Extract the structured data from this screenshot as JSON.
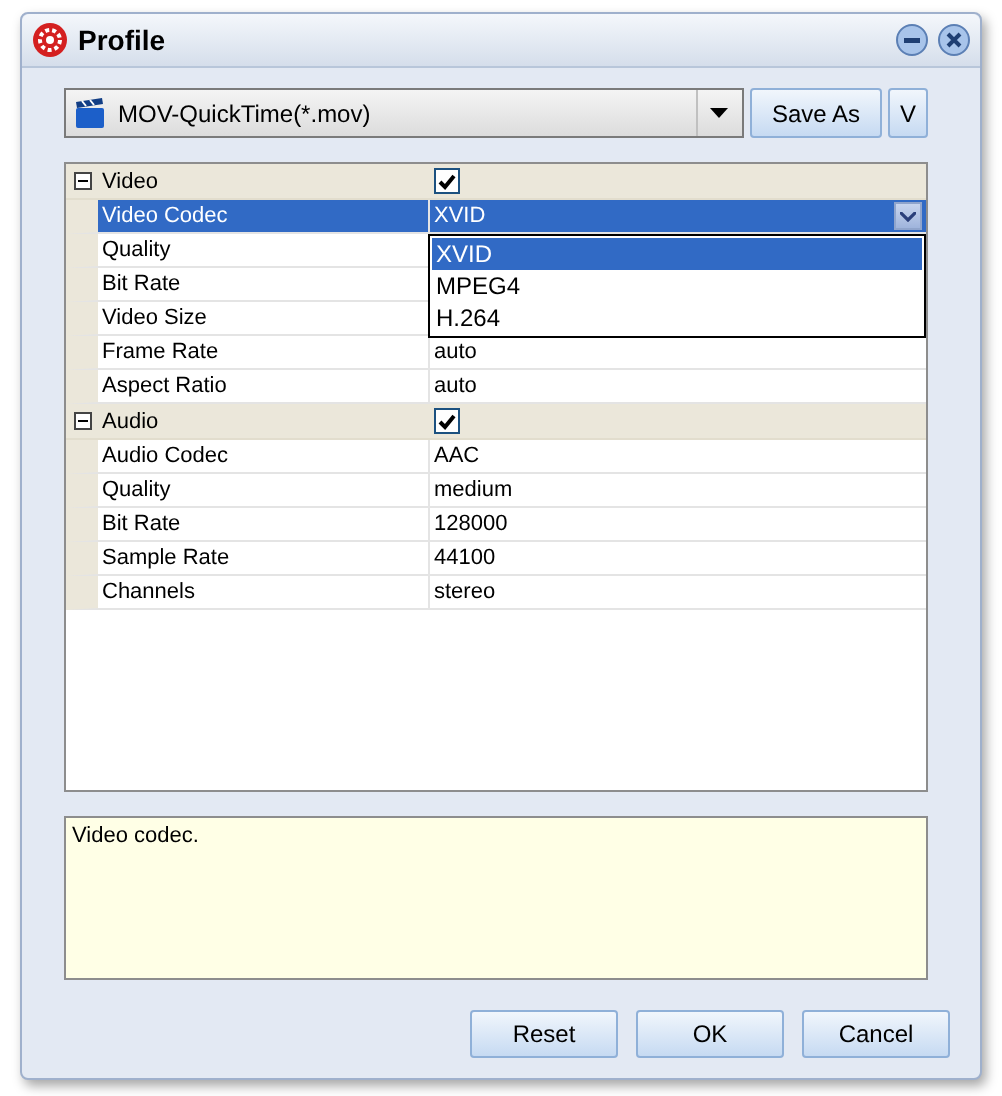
{
  "window": {
    "title": "Profile"
  },
  "profile": {
    "value": "MOV-QuickTime(*.mov)"
  },
  "top_buttons": [
    "Save As",
    "V"
  ],
  "grid": {
    "sections": [
      {
        "label": "Video",
        "expanded": true,
        "checked": true,
        "rows": [
          {
            "label": "Video Codec",
            "value": "XVID",
            "selected": true,
            "dropdown": {
              "options": [
                {
                  "label": "XVID",
                  "selected": true
                },
                {
                  "label": "MPEG4",
                  "selected": false
                },
                {
                  "label": "H.264",
                  "selected": false
                }
              ]
            }
          },
          {
            "label": "Quality",
            "selected": false
          },
          {
            "label": "Bit Rate",
            "selected": false
          },
          {
            "label": "Video Size",
            "selected": false
          },
          {
            "label": "Frame Rate",
            "value": "auto",
            "selected": false
          },
          {
            "label": "Aspect Ratio",
            "value": "auto",
            "selected": false
          }
        ]
      },
      {
        "label": "Audio",
        "expanded": true,
        "checked": true,
        "rows": [
          {
            "label": "Audio Codec",
            "value": "AAC",
            "selected": false
          },
          {
            "label": "Quality",
            "value": "medium",
            "selected": false
          },
          {
            "label": "Bit Rate",
            "value": "128000",
            "selected": false
          },
          {
            "label": "Sample Rate",
            "value": "44100",
            "selected": false
          },
          {
            "label": "Channels",
            "value": "stereo",
            "selected": false
          }
        ]
      }
    ]
  },
  "description": "Video codec.",
  "buttons": [
    "Reset",
    "OK",
    "Cancel"
  ]
}
